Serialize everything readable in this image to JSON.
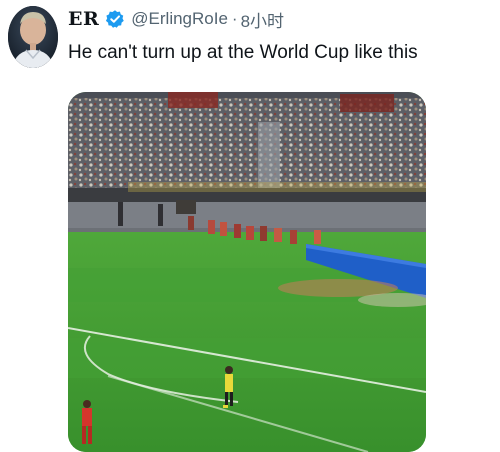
{
  "tweet": {
    "display_name": "ER",
    "handle": "@ErlingRoIe",
    "separator": "·",
    "time": "8小时",
    "text": "He can't turn up at the World Cup like this",
    "verified_icon": "verified-badge-icon",
    "avatar_icon": "profile-avatar",
    "media_description_icon": "football-stadium-video"
  },
  "colors": {
    "verified_blue": "#1d9bf0",
    "text": "#0f1419",
    "secondary_text": "#536471",
    "pitch_green": "#3d9a2f"
  }
}
